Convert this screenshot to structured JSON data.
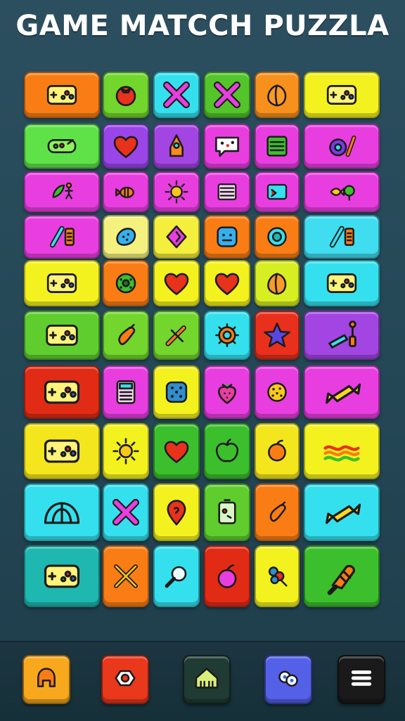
{
  "title": "GAME MATCCH PUZZLA",
  "board": {
    "rows": [
      {
        "tiles": [
          {
            "icon": "gamepad-icon",
            "color": "#f97d14"
          },
          {
            "icon": "tomato-icon",
            "color": "#72d62d"
          },
          {
            "icon": "x-mark-icon",
            "color": "#35e0ee"
          },
          {
            "icon": "x-mark-icon",
            "color": "#53c52b"
          },
          {
            "icon": "peach-icon",
            "color": "#f7901c"
          },
          {
            "icon": "gamepad-icon",
            "color": "#f4f21e"
          }
        ]
      },
      {
        "tiles": [
          {
            "icon": "candy-bar-icon",
            "color": "#5fe248"
          },
          {
            "icon": "heart-icon",
            "color": "#9a45e8"
          },
          {
            "icon": "rocket-icon",
            "color": "#a245e2"
          },
          {
            "icon": "speech-bubble-icon",
            "color": "#e83ee0"
          },
          {
            "icon": "lines-box-icon",
            "color": "#e83ee0"
          },
          {
            "icon": "disc-and-pencil-icon",
            "color": "#e83ee0"
          }
        ]
      },
      {
        "tiles": [
          {
            "icon": "leaf-and-figure-icon",
            "color": "#e83ee0"
          },
          {
            "icon": "candy-wrap-icon",
            "color": "#e83ee0"
          },
          {
            "icon": "sun-icon",
            "color": "#e83ee0"
          },
          {
            "icon": "window-icon",
            "color": "#e83ee0"
          },
          {
            "icon": "card-icon",
            "color": "#e83ee0"
          },
          {
            "icon": "fish-and-bush-icon",
            "color": "#e83ee0"
          }
        ]
      },
      {
        "tiles": [
          {
            "icon": "pencil-and-battery-icon",
            "color": "#e83ee0"
          },
          {
            "icon": "blob-icon",
            "color": "#f5f17e"
          },
          {
            "icon": "diamond-icon",
            "color": "#f4ef3c"
          },
          {
            "icon": "square-face-icon",
            "color": "#f97d14"
          },
          {
            "icon": "ring-icon",
            "color": "#f97d14"
          },
          {
            "icon": "pencil-and-battery-icon",
            "color": "#40dcef"
          }
        ]
      },
      {
        "tiles": [
          {
            "icon": "gamepad-icon",
            "color": "#f4f21e"
          },
          {
            "icon": "cookie-icon",
            "color": "#f97d14"
          },
          {
            "icon": "heart-icon",
            "color": "#f4f21e"
          },
          {
            "icon": "heart-icon",
            "color": "#f4f21e"
          },
          {
            "icon": "peach-icon",
            "color": "#d6ee22"
          },
          {
            "icon": "gamepad-icon",
            "color": "#35e0ee"
          }
        ]
      },
      {
        "tiles": [
          {
            "icon": "gamepad-icon",
            "color": "#5fcd2e"
          },
          {
            "icon": "bottle-icon",
            "color": "#72d62d"
          },
          {
            "icon": "swords-icon",
            "color": "#72d62d"
          },
          {
            "icon": "gear-icon",
            "color": "#35e0ee"
          },
          {
            "icon": "star-icon",
            "color": "#e9301c"
          },
          {
            "icon": "rocket-and-pin-icon",
            "color": "#a245e2"
          }
        ]
      },
      {
        "tiles": [
          {
            "icon": "gamepad-icon",
            "color": "#e22b15"
          },
          {
            "icon": "calculator-icon",
            "color": "#e83ee0"
          },
          {
            "icon": "dice-icon",
            "color": "#f4f21e"
          },
          {
            "icon": "strawberry-icon",
            "color": "#e83ee0"
          },
          {
            "icon": "cookie-dots-icon",
            "color": "#e83ee0"
          },
          {
            "icon": "wrapped-candy-icon",
            "color": "#e83ee0"
          }
        ]
      },
      {
        "tiles": [
          {
            "icon": "gamepad-icon",
            "color": "#f4e61c"
          },
          {
            "icon": "sun-icon",
            "color": "#f4f21e"
          },
          {
            "icon": "heart-icon",
            "color": "#3cbf2c"
          },
          {
            "icon": "apple-icon",
            "color": "#3cbf2c"
          },
          {
            "icon": "orange-icon",
            "color": "#f4e61c"
          },
          {
            "icon": "wave-lines-icon",
            "color": "#f4f21e"
          }
        ]
      },
      {
        "tiles": [
          {
            "icon": "dome-icon",
            "color": "#35e0ee"
          },
          {
            "icon": "x-mark-icon",
            "color": "#35e0ee"
          },
          {
            "icon": "map-pin-icon",
            "color": "#f4f21e"
          },
          {
            "icon": "battery-icon",
            "color": "#5fcd2e"
          },
          {
            "icon": "bottle-icon",
            "color": "#f97d14"
          },
          {
            "icon": "wrapped-candy-icon",
            "color": "#35e0ee"
          }
        ]
      },
      {
        "tiles": [
          {
            "icon": "gamepad-icon",
            "color": "#1eb8b0"
          },
          {
            "icon": "crossed-swords-icon",
            "color": "#f97d14"
          },
          {
            "icon": "magnifier-icon",
            "color": "#35e0ee"
          },
          {
            "icon": "cherry-icon",
            "color": "#e22b15"
          },
          {
            "icon": "flower-icon",
            "color": "#f4f21e"
          },
          {
            "icon": "ice-pop-icon",
            "color": "#3cbf2c"
          }
        ]
      }
    ]
  },
  "bottom_nav": [
    {
      "name": "helmet-button",
      "icon": "helmet-icon",
      "color": "#f7a81c"
    },
    {
      "name": "badge-button",
      "icon": "badge-icon",
      "color": "#e9381c"
    },
    {
      "name": "home-button",
      "icon": "home-icon",
      "color": "#1f3b33"
    },
    {
      "name": "controller-button",
      "icon": "controller-icon",
      "color": "#5460e8"
    },
    {
      "name": "menu-button",
      "icon": "menu-icon",
      "color": "#1a1a1a"
    }
  ]
}
